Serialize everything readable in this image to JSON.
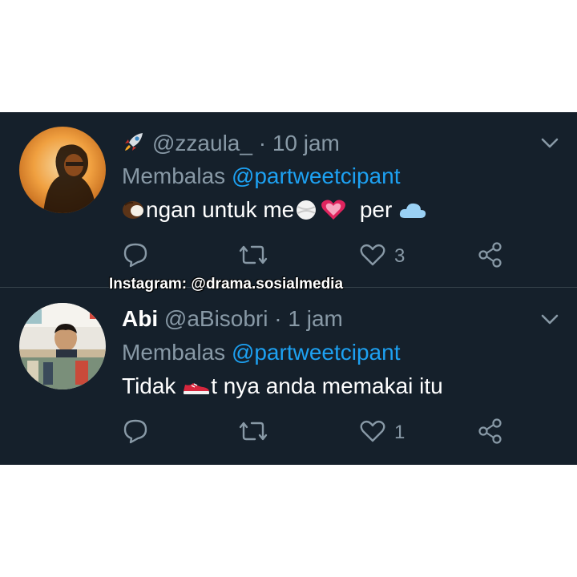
{
  "tweets": [
    {
      "display_name": "",
      "handle": "@zzaula_",
      "time": "· 10 jam",
      "reply_prefix": "Membalas ",
      "reply_mention": "@partweetcipant",
      "text_parts": [
        "ngan untuk me",
        "per"
      ],
      "emojis": [
        "rocket-icon",
        "coconut-icon",
        "ball-icon",
        "heart-icon",
        "cloud-icon"
      ],
      "reply_count": "",
      "retweet_count": "",
      "like_count": "3"
    },
    {
      "display_name": "Abi",
      "handle": "@aBisobri",
      "time": "· 1 jam",
      "reply_prefix": "Membalas ",
      "reply_mention": "@partweetcipant",
      "text_parts": [
        "Tidak ",
        "t nya anda memakai itu"
      ],
      "emojis": [
        "shoe-icon"
      ],
      "reply_count": "",
      "retweet_count": "",
      "like_count": "1"
    }
  ],
  "watermark": "Instagram: @drama.sosialmedia",
  "colors": {
    "background": "#15202b",
    "text": "#ffffff",
    "muted": "#8899a6",
    "link": "#1da1f2",
    "divider": "#38444d"
  }
}
